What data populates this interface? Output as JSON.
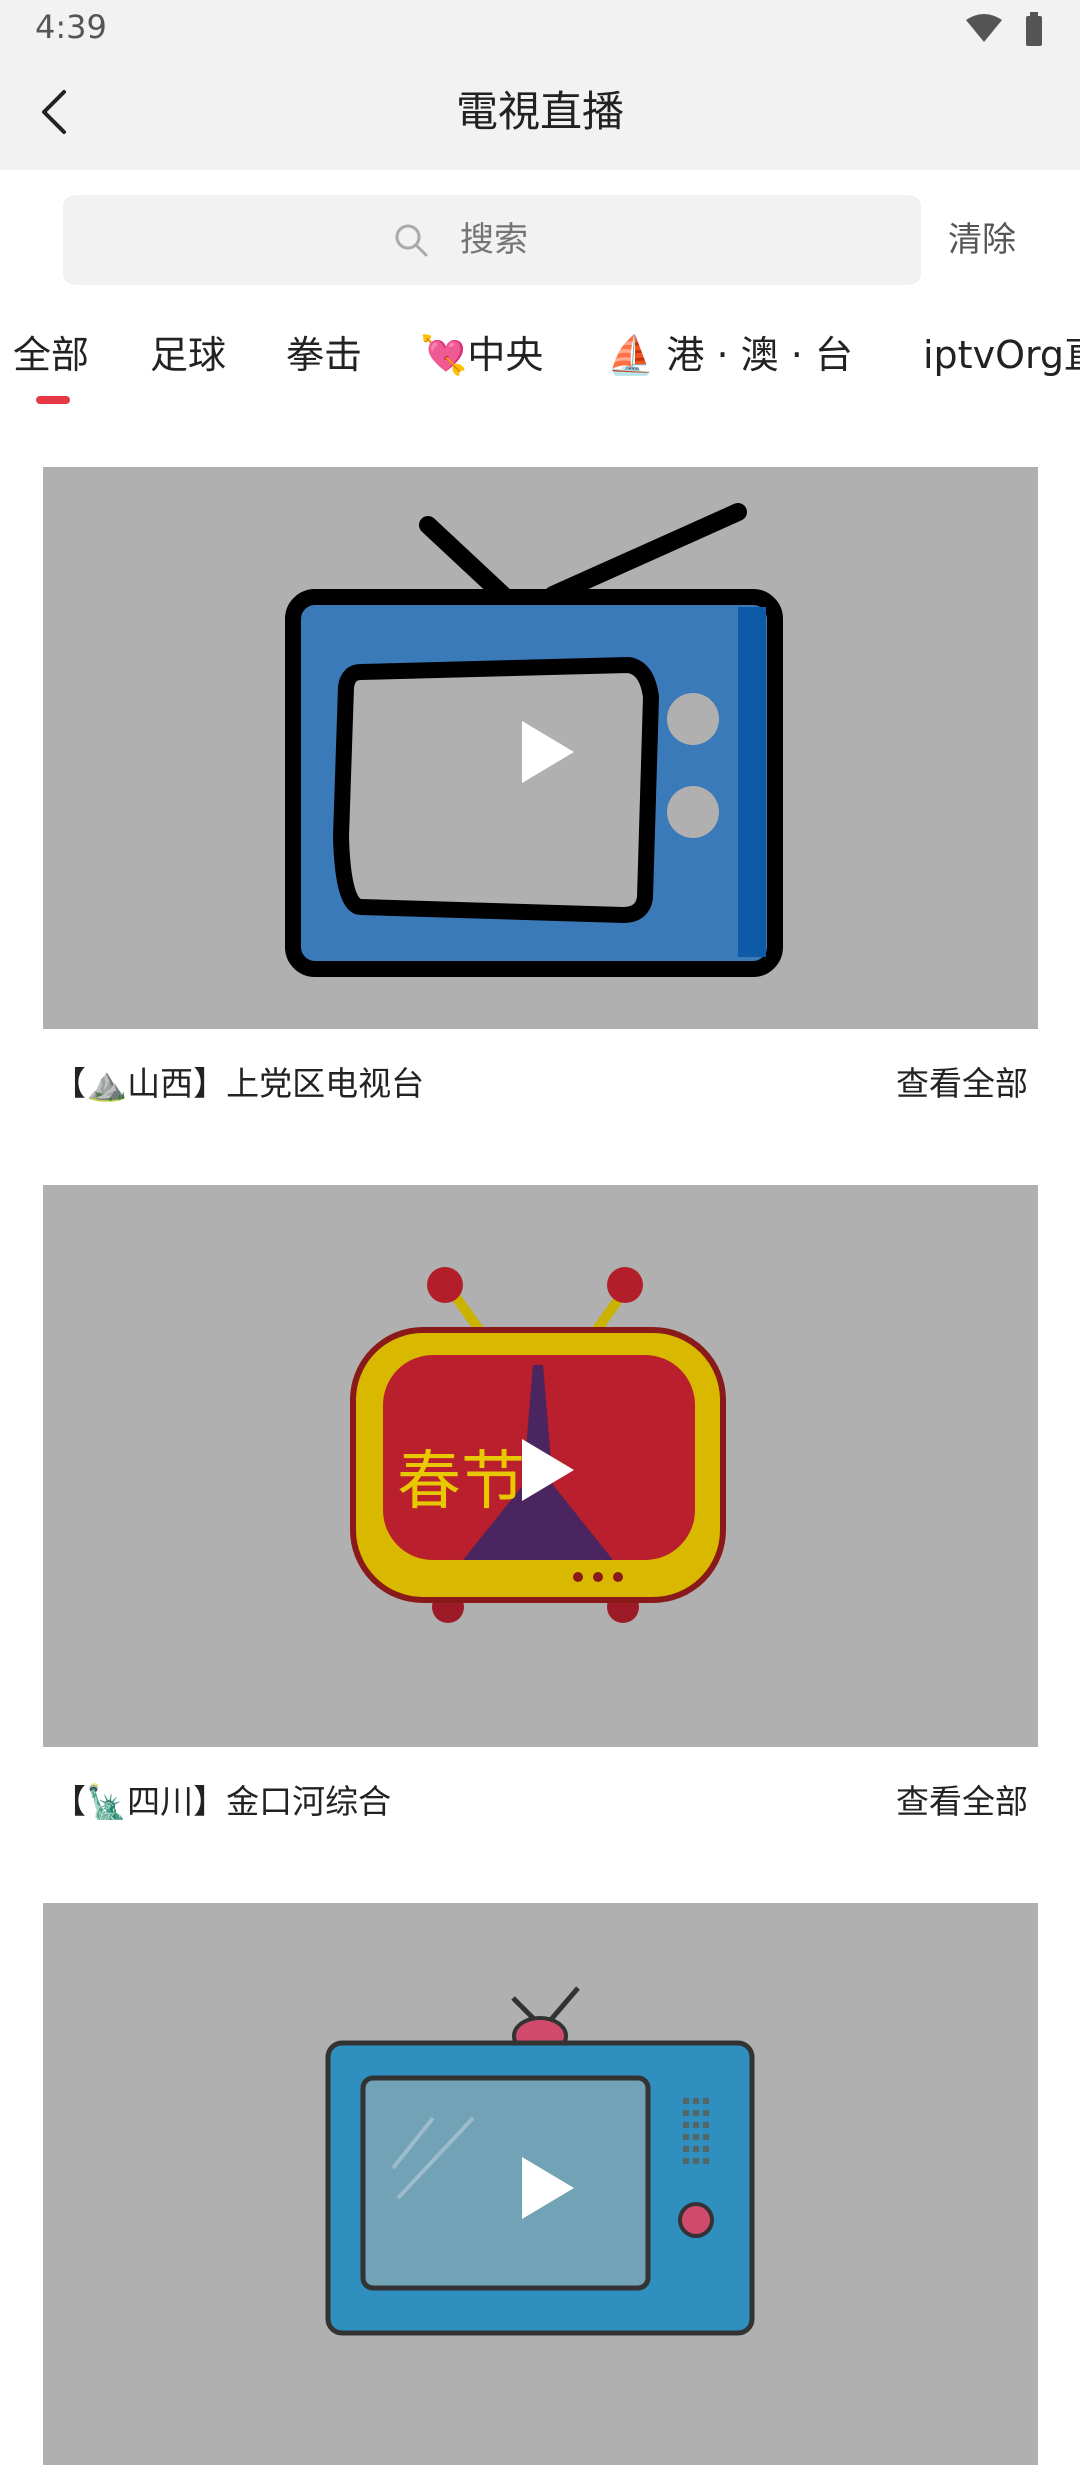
{
  "status_bar": {
    "time": "4:39"
  },
  "header": {
    "title": "電視直播"
  },
  "search": {
    "placeholder": "搜索",
    "clear_label": "清除"
  },
  "tabs": [
    {
      "label": "全部",
      "active": true
    },
    {
      "label": "足球"
    },
    {
      "label": "拳击"
    },
    {
      "label": "💘中央"
    },
    {
      "label": "⛵ 港 · 澳 · 台"
    },
    {
      "label": "iptvOrg直"
    }
  ],
  "accent_color": "#e63946",
  "channels": [
    {
      "name": "【⛰️山西】上党区电视台",
      "view_all": "查看全部"
    },
    {
      "name": "【🗽四川】金口河综合",
      "view_all": "查看全部"
    },
    {
      "name": "",
      "view_all": ""
    }
  ],
  "thumbnail_text": {
    "spring_festival": "春节"
  }
}
